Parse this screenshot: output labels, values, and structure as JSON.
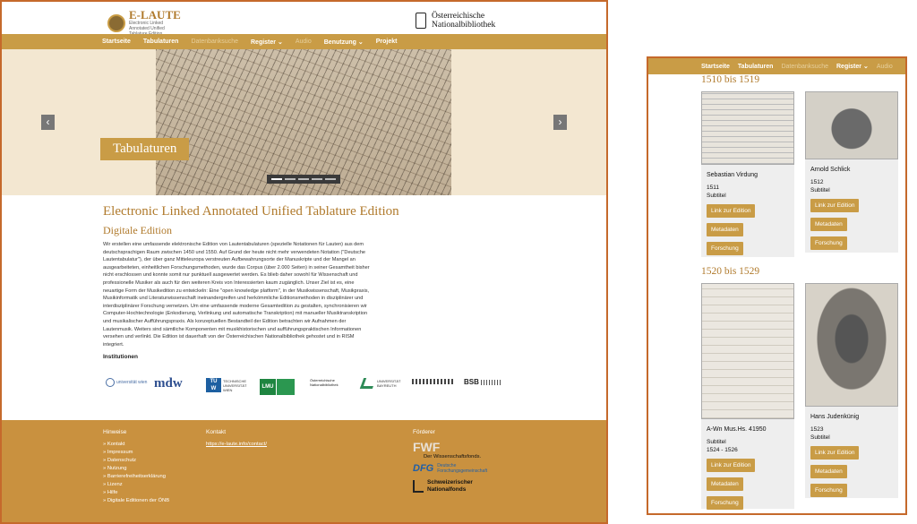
{
  "left": {
    "logo": {
      "title": "E-LAUTE",
      "subtitle": "Electronic Linked Annotated Unified Tablature Edition"
    },
    "onb_logo": {
      "line1": "Österreichische",
      "line2": "Nationalbibliothek"
    },
    "nav": [
      "Startseite",
      "Tabulaturen",
      "Datenbanksuche",
      "Register",
      "Audio",
      "Benutzung",
      "Projekt"
    ],
    "hero": {
      "label": "Tabulaturen",
      "prev": "‹",
      "next": "›"
    },
    "heading": "Electronic Linked Annotated Unified Tablature Edition",
    "subheading": "Digitale Edition",
    "body": "Wir erstellen eine umfassende elektronische Edition von Lautentabulaturen (spezielle Notationen für Lauten) aus dem deutschsprachigen Raum zwischen 1450 und 1550. Auf Grund der heute nicht mehr verwendeten Notation (\"Deutsche Lautentabulatur\"), der über ganz Mitteleuropa verstreuten Aufbewahrungsorte der Manuskripte und der Mangel an ausgearbeiteten, einheitlichen Forschungsmethoden, wurde das Corpus (über 2.000 Seiten) in seiner Gesamtheit bisher nicht erschlossen und konnte somit nur punktuell ausgewertet werden. Es blieb daher sowohl für Wissenschaft und professionelle Musiker als auch für den weiteren Kreis von Interessierten kaum zugänglich. Unser Ziel ist es, eine neuartige Form der Musikedition zu entwickeln: Eine \"open knowledge platform\", in der Musikwissenschaft, Musikpraxis, Musikinformatik und Literaturwissenschaft ineinandergreifen und herkömmliche Editionsmethoden in disziplinärer und interdisziplinärer Forschung vernetzen. Um eine umfassende moderne Gesamtedition zu gestalten, synchronisieren wir Computer-Hochtechnologie (Enkodierung, Verlinkung und automatische Transkription) mit manueller Musiktranskription und musikalischer Aufführungspraxis. Als konzeptuellen Bestandteil der Edition betrachten wir Aufnahmen der Lautenmusik. Weiters sind sämtliche Komponenten mit musikhistorischen und aufführungspraktischen Informationen versehen und verlinkt. Die Edition ist dauerhaft von der Österreichischen Nationalbibliothek gehostet und in RISM integriert.",
    "institutions_label": "Institutionen",
    "institutions": [
      "universität wien",
      "mdw",
      "TECHNISCHE UNIVERSITÄT WIEN",
      "LMU",
      "Österreichische Nationalbibliothek",
      "UNIVERSITÄT BAYREUTH",
      "BSB"
    ],
    "footer": {
      "hinweise_title": "Hinweise",
      "hinweise": [
        "» Kontakt",
        "» Impressum",
        "» Datenschutz",
        "» Nutzung",
        "» Barrierefreiheitserklärung",
        "» Lizenz",
        "» Hilfe",
        "» Digitale Editionen der ÖNB"
      ],
      "kontakt_title": "Kontakt",
      "kontakt_link": "https://e-laute.info/contact/",
      "foerderer_title": "Förderer",
      "fwf": "FWF",
      "fwf_sub": "Der Wissenschaftsfonds.",
      "dfg": "DFG",
      "dfg_sub": "Deutsche Forschungsgemeinschaft",
      "snf": "Schweizerischer Nationalfonds"
    }
  },
  "right": {
    "nav": [
      "Startseite",
      "Tabulaturen",
      "Datenbanksuche",
      "Register",
      "Audio"
    ],
    "section1": "1510 bis 1519",
    "section2": "1520 bis 1529",
    "cards": [
      {
        "name": "Sebastian Virdung",
        "year": "1511",
        "subtitle": "Subtitel",
        "b1": "Link zur Edition",
        "b2": "Metadaten",
        "b3": "Forschung"
      },
      {
        "name": "Arnold Schlick",
        "year": "1512",
        "subtitle": "Subtitel",
        "b1": "Link zur Edition",
        "b2": "Metadaten",
        "b3": "Forschung"
      },
      {
        "name": "A-Wn Mus.Hs. 41950",
        "year": "Subtitel",
        "subtitle": "1524 - 1526",
        "b1": "Link zur Edition",
        "b2": "Metadaten",
        "b3": "Forschung"
      },
      {
        "name": "Hans Judenkünig",
        "year": "1523",
        "subtitle": "Subtitel",
        "b1": "Link zur Edition",
        "b2": "Metadaten",
        "b3": "Forschung"
      }
    ]
  }
}
